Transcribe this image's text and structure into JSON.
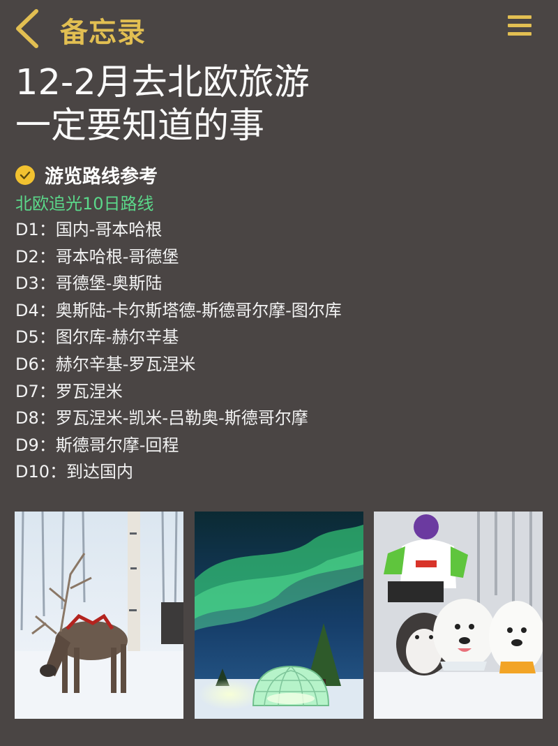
{
  "header": {
    "back_icon": "chevron-left-icon",
    "title": "备忘录",
    "menu_icon": "hamburger-menu-icon"
  },
  "note": {
    "title_line1": "12-2月去北欧旅游",
    "title_line2": "一定要知道的事",
    "section_icon": "checkmark-circle-icon",
    "section_title": "游览路线参考",
    "route_name": "北欧追光10日路线",
    "days": [
      "D1：国内-哥本哈根",
      "D2：哥本哈根-哥德堡",
      "D3：哥德堡-奥斯陆",
      "D4：奥斯陆-卡尔斯塔德-斯德哥尔摩-图尔库",
      "D5：图尔库-赫尔辛基",
      "D6：赫尔辛基-罗瓦涅米",
      "D7：罗瓦涅米",
      "D8：罗瓦涅米-凯米-吕勒奥-斯德哥尔摩",
      "D9：斯德哥尔摩-回程",
      "D10：到达国内"
    ]
  },
  "photos": [
    "reindeer-in-snow-photo",
    "aurora-glass-igloo-photo",
    "husky-samoyed-sled-photo"
  ],
  "colors": {
    "background": "#4a4544",
    "accent": "#e2bf52",
    "route_green": "#5bd88a",
    "check_yellow": "#f2c230"
  }
}
